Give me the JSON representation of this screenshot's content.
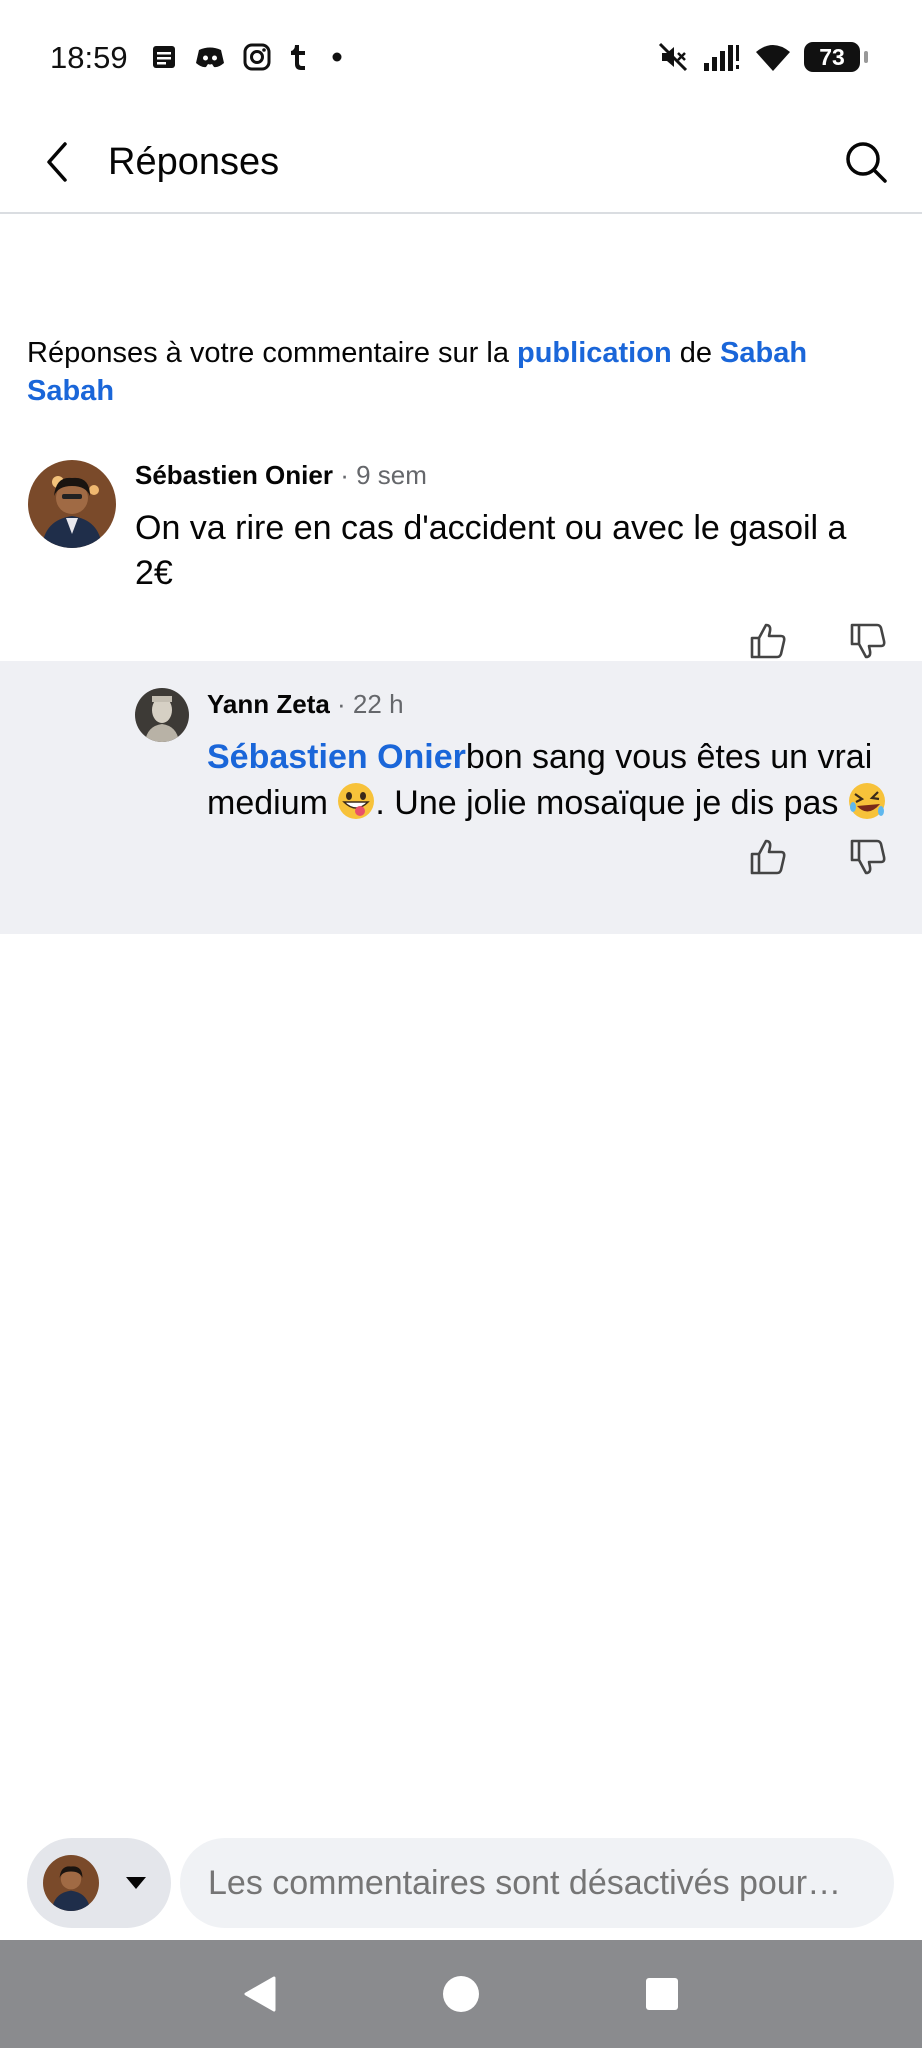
{
  "status_bar": {
    "time": "18:59",
    "battery": "73",
    "left_icons": [
      "notes-icon",
      "discord-icon",
      "instagram-icon",
      "tumblr-icon",
      "dot-icon"
    ],
    "right_icons": [
      "mute-icon",
      "signal-icon",
      "wifi-icon",
      "battery-icon"
    ]
  },
  "header": {
    "title": "Réponses",
    "back_icon": "back-arrow-icon",
    "search_icon": "search-icon"
  },
  "context": {
    "prefix": "Réponses à votre commentaire sur la ",
    "post_link": "publication",
    "middle": " de ",
    "author_link": "Sabah Sabah"
  },
  "comment": {
    "author": "Sébastien Onier",
    "time": " · 9 sem",
    "text": "On va rire en cas d'accident ou avec le gasoil a 2€"
  },
  "reply": {
    "author": "Yann Zeta",
    "time": " · 22 h",
    "mention": "Sébastien Onier",
    "text_part1": "bon sang vous êtes un vrai medium ",
    "text_part2": ". Une jolie mosaïque je dis pas "
  },
  "composer": {
    "placeholder": "Les commentaires sont désactivés pour…"
  },
  "colors": {
    "link": "#1a66d9",
    "reply_background": "#eff0f4",
    "nav_bar": "#8a8b8e"
  }
}
